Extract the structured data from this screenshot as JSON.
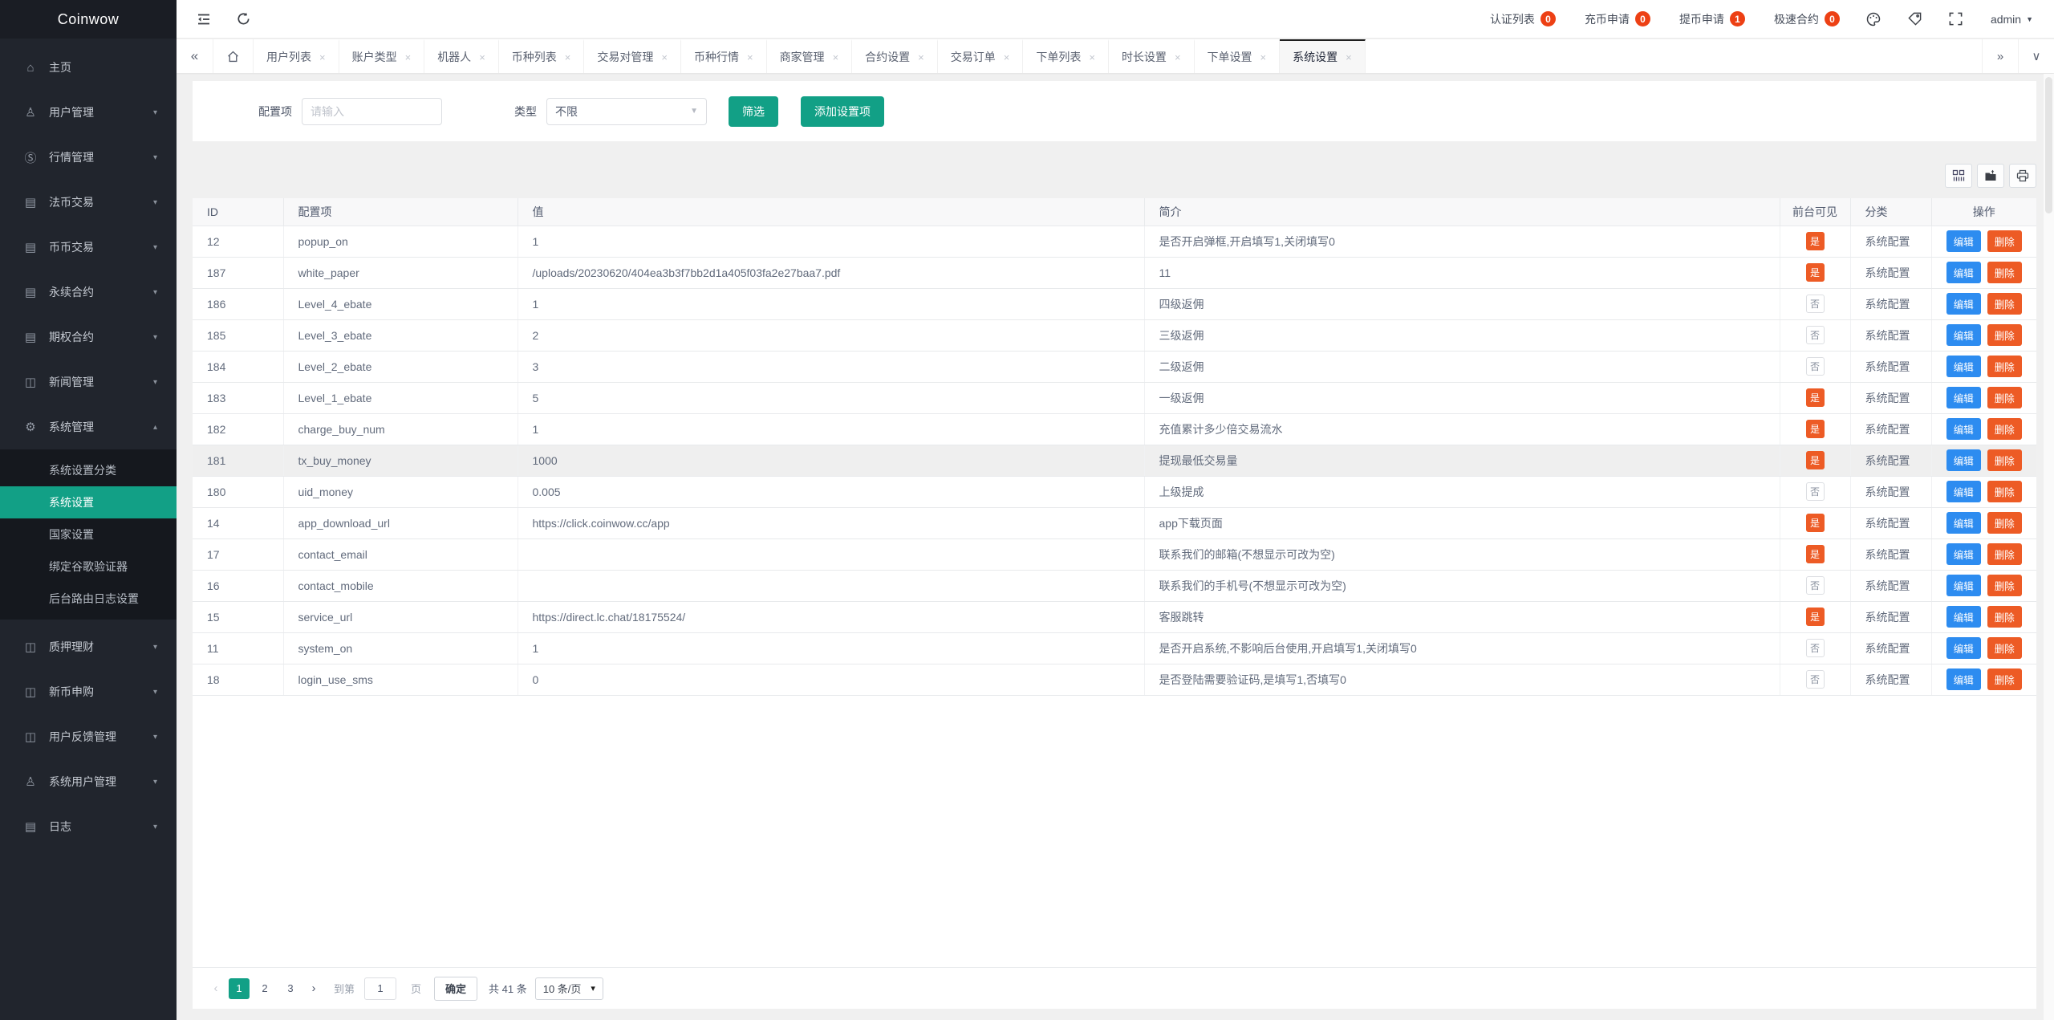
{
  "app": {
    "logo": "Coinwow"
  },
  "header": {
    "shortcuts": [
      {
        "label": "认证列表",
        "count": "0"
      },
      {
        "label": "充币申请",
        "count": "0"
      },
      {
        "label": "提币申请",
        "count": "1"
      },
      {
        "label": "极速合约",
        "count": "0"
      }
    ],
    "user": "admin",
    "user_caret": "▼",
    "icon_names": [
      "menu-fold-icon",
      "refresh-icon",
      "palette-icon",
      "tag-icon",
      "fullscreen-icon"
    ]
  },
  "tabs": {
    "collapse_left": "«",
    "collapse_right": "»",
    "dropdown": "∨",
    "close_glyph": "×",
    "items": [
      {
        "label": "用户列表"
      },
      {
        "label": "账户类型"
      },
      {
        "label": "机器人"
      },
      {
        "label": "币种列表"
      },
      {
        "label": "交易对管理"
      },
      {
        "label": "币种行情"
      },
      {
        "label": "商家管理"
      },
      {
        "label": "合约设置"
      },
      {
        "label": "交易订单"
      },
      {
        "label": "下单列表"
      },
      {
        "label": "时长设置"
      },
      {
        "label": "下单设置"
      },
      {
        "label": "系统设置",
        "active": true
      }
    ]
  },
  "sidebar": {
    "items_top": [
      {
        "label": "主页",
        "icon_name": "home-icon",
        "icon_glyph": "⌂",
        "caret": ""
      },
      {
        "label": "用户管理",
        "icon_name": "users-icon",
        "icon_glyph": "♙",
        "caret": "▾"
      },
      {
        "label": "行情管理",
        "icon_name": "market-icon",
        "icon_glyph": "Ⓢ",
        "caret": "▾"
      },
      {
        "label": "法币交易",
        "icon_name": "fiat-trade-icon",
        "icon_glyph": "▤",
        "caret": "▾"
      },
      {
        "label": "币币交易",
        "icon_name": "coin-trade-icon",
        "icon_glyph": "▤",
        "caret": "▾"
      },
      {
        "label": "永续合约",
        "icon_name": "perpetual-contract-icon",
        "icon_glyph": "▤",
        "caret": "▾"
      },
      {
        "label": "期权合约",
        "icon_name": "options-contract-icon",
        "icon_glyph": "▤",
        "caret": "▾"
      },
      {
        "label": "新闻管理",
        "icon_name": "news-icon",
        "icon_glyph": "◫",
        "caret": "▾"
      },
      {
        "label": "系统管理",
        "icon_name": "gear-icon",
        "icon_glyph": "⚙",
        "caret": "▴",
        "expanded": true
      }
    ],
    "submenu": [
      {
        "label": "系统设置分类"
      },
      {
        "label": "系统设置",
        "active": true
      },
      {
        "label": "国家设置"
      },
      {
        "label": "绑定谷歌验证器"
      },
      {
        "label": "后台路由日志设置"
      }
    ],
    "items_bottom": [
      {
        "label": "质押理财",
        "icon_name": "finance-icon",
        "icon_glyph": "◫",
        "caret": "▾"
      },
      {
        "label": "新币申购",
        "icon_name": "new-coin-icon",
        "icon_glyph": "◫",
        "caret": "▾"
      },
      {
        "label": "用户反馈管理",
        "icon_name": "feedback-icon",
        "icon_glyph": "◫",
        "caret": "▾"
      },
      {
        "label": "系统用户管理",
        "icon_name": "system-users-icon",
        "icon_glyph": "♙",
        "caret": "▾"
      },
      {
        "label": "日志",
        "icon_name": "log-icon",
        "icon_glyph": "▤",
        "caret": "▾"
      }
    ]
  },
  "filter": {
    "config_label": "配置项",
    "config_placeholder": "请输入",
    "type_label": "类型",
    "type_value": "不限",
    "search_label": "筛选",
    "add_label": "添加设置项"
  },
  "toolbar": {
    "icon_names": [
      "columns-icon",
      "export-icon",
      "print-icon"
    ]
  },
  "table": {
    "columns": [
      "ID",
      "配置项",
      "值",
      "简介",
      "前台可见",
      "分类",
      "操作"
    ],
    "edit_label": "编辑",
    "delete_label": "删除",
    "rows": [
      {
        "id": "12",
        "key": "popup_on",
        "value": "1",
        "desc": "是否开启弹框,开启填写1,关闭填写0",
        "visible": "是",
        "visible_on": true,
        "category": "系统配置"
      },
      {
        "id": "187",
        "key": "white_paper",
        "value": "/uploads/20230620/404ea3b3f7bb2d1a405f03fa2e27baa7.pdf",
        "desc": "11",
        "visible": "是",
        "visible_on": true,
        "category": "系统配置"
      },
      {
        "id": "186",
        "key": "Level_4_ebate",
        "value": "1",
        "desc": "四级返佣",
        "visible": "否",
        "visible_on": false,
        "category": "系统配置"
      },
      {
        "id": "185",
        "key": "Level_3_ebate",
        "value": "2",
        "desc": "三级返佣",
        "visible": "否",
        "visible_on": false,
        "category": "系统配置"
      },
      {
        "id": "184",
        "key": "Level_2_ebate",
        "value": "3",
        "desc": "二级返佣",
        "visible": "否",
        "visible_on": false,
        "category": "系统配置"
      },
      {
        "id": "183",
        "key": "Level_1_ebate",
        "value": "5",
        "desc": "一级返佣",
        "visible": "是",
        "visible_on": true,
        "category": "系统配置"
      },
      {
        "id": "182",
        "key": "charge_buy_num",
        "value": "1",
        "desc": "充值累计多少倍交易流水",
        "visible": "是",
        "visible_on": true,
        "category": "系统配置"
      },
      {
        "id": "181",
        "key": "tx_buy_money",
        "value": "1000",
        "desc": "提现最低交易量",
        "visible": "是",
        "visible_on": true,
        "category": "系统配置",
        "highlight": true
      },
      {
        "id": "180",
        "key": "uid_money",
        "value": "0.005",
        "desc": "上级提成",
        "visible": "否",
        "visible_on": false,
        "category": "系统配置"
      },
      {
        "id": "14",
        "key": "app_download_url",
        "value": "https://click.coinwow.cc/app",
        "desc": "app下载页面",
        "visible": "是",
        "visible_on": true,
        "category": "系统配置"
      },
      {
        "id": "17",
        "key": "contact_email",
        "value": "",
        "desc": "联系我们的邮箱(不想显示可改为空)",
        "visible": "是",
        "visible_on": true,
        "category": "系统配置"
      },
      {
        "id": "16",
        "key": "contact_mobile",
        "value": "",
        "desc": "联系我们的手机号(不想显示可改为空)",
        "visible": "否",
        "visible_on": false,
        "category": "系统配置"
      },
      {
        "id": "15",
        "key": "service_url",
        "value": "https://direct.lc.chat/18175524/",
        "desc": "客服跳转",
        "visible": "是",
        "visible_on": true,
        "category": "系统配置"
      },
      {
        "id": "11",
        "key": "system_on",
        "value": "1",
        "desc": "是否开启系统,不影响后台使用,开启填写1,关闭填写0",
        "visible": "否",
        "visible_on": false,
        "category": "系统配置"
      },
      {
        "id": "18",
        "key": "login_use_sms",
        "value": "0",
        "desc": "是否登陆需要验证码,是填写1,否填写0",
        "visible": "否",
        "visible_on": false,
        "category": "系统配置"
      }
    ]
  },
  "pagination": {
    "prev": "‹",
    "next": "›",
    "pages": [
      {
        "label": "1",
        "active": true
      },
      {
        "label": "2"
      },
      {
        "label": "3"
      }
    ],
    "jump_prefix": "到第",
    "jump_value": "1",
    "jump_suffix": "页",
    "confirm_label": "确定",
    "total": "共 41 条",
    "page_size": "10 条/页",
    "size_caret": "▾"
  },
  "colors": {
    "accent_teal": "#12a086",
    "edit_blue": "#2d8cf0",
    "danger_orange": "#ed5b25",
    "badge_red": "#ed4014",
    "sidebar_bg": "#21252d"
  }
}
